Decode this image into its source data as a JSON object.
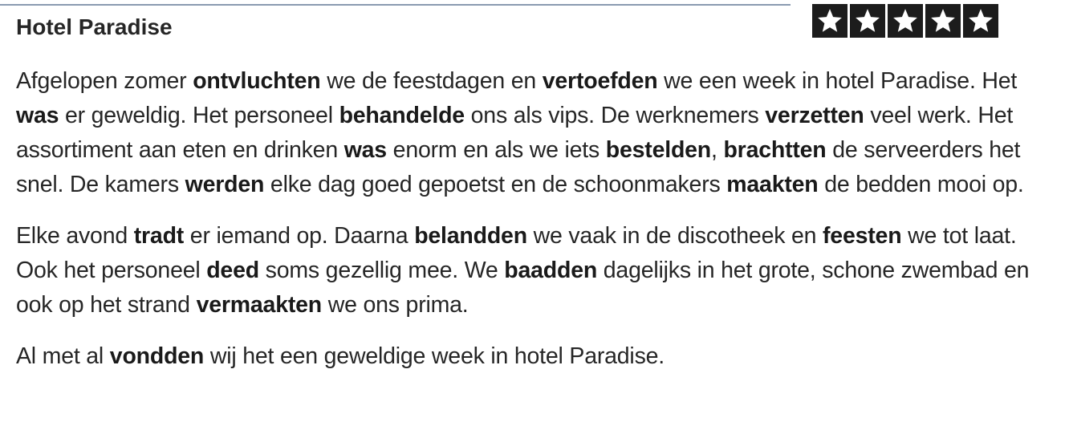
{
  "review": {
    "title": "Hotel Paradise",
    "rating": {
      "stars": 5,
      "max": 5,
      "icon": "star-icon",
      "box_color": "#1c1c1c",
      "star_color": "#ffffff"
    },
    "paragraphs": [
      [
        {
          "text": "Afgelopen zomer ",
          "bold": false
        },
        {
          "text": "ontvluchten",
          "bold": true
        },
        {
          "text": " we de feestdagen en ",
          "bold": false
        },
        {
          "text": "vertoefden",
          "bold": true
        },
        {
          "text": " we een week in hotel Paradise. Het ",
          "bold": false
        },
        {
          "text": "was",
          "bold": true
        },
        {
          "text": " er geweldig. Het personeel ",
          "bold": false
        },
        {
          "text": "behandelde",
          "bold": true
        },
        {
          "text": " ons als vips. De werknemers ",
          "bold": false
        },
        {
          "text": "verzetten",
          "bold": true
        },
        {
          "text": " veel werk. Het assortiment aan eten en drinken ",
          "bold": false
        },
        {
          "text": "was",
          "bold": true
        },
        {
          "text": " enorm en als we iets ",
          "bold": false
        },
        {
          "text": "bestelden",
          "bold": true
        },
        {
          "text": ", ",
          "bold": false
        },
        {
          "text": "brachtten",
          "bold": true
        },
        {
          "text": " de serveerders het snel. De kamers ",
          "bold": false
        },
        {
          "text": "werden",
          "bold": true
        },
        {
          "text": " elke dag goed gepoetst en de schoonmakers ",
          "bold": false
        },
        {
          "text": "maakten",
          "bold": true
        },
        {
          "text": " de bedden mooi op.",
          "bold": false
        }
      ],
      [
        {
          "text": "Elke avond ",
          "bold": false
        },
        {
          "text": "tradt",
          "bold": true
        },
        {
          "text": " er iemand op. Daarna ",
          "bold": false
        },
        {
          "text": "belandden",
          "bold": true
        },
        {
          "text": " we vaak in de discotheek en ",
          "bold": false
        },
        {
          "text": "feesten",
          "bold": true
        },
        {
          "text": " we tot laat. Ook het personeel ",
          "bold": false
        },
        {
          "text": "deed",
          "bold": true
        },
        {
          "text": " soms gezellig mee. We ",
          "bold": false
        },
        {
          "text": "baadden",
          "bold": true
        },
        {
          "text": " dagelijks in het grote, schone zwembad en ook op het strand ",
          "bold": false
        },
        {
          "text": "vermaakten",
          "bold": true
        },
        {
          "text": " we ons prima.",
          "bold": false
        }
      ],
      [
        {
          "text": "Al met al ",
          "bold": false
        },
        {
          "text": "vondden",
          "bold": true
        },
        {
          "text": " wij het een geweldige week in hotel Paradise.",
          "bold": false
        }
      ]
    ]
  }
}
